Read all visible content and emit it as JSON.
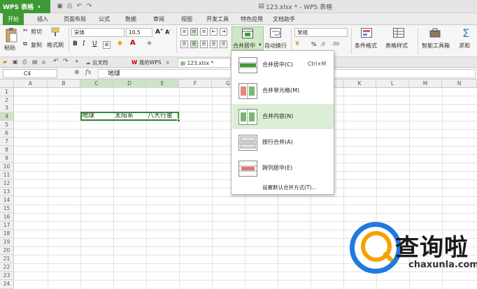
{
  "titlebar": {
    "app_name": "WPS 表格",
    "document_title": "123.xlsx * - WPS 表格"
  },
  "tabs": [
    "开始",
    "插入",
    "页面布局",
    "公式",
    "数据",
    "审阅",
    "视图",
    "开发工具",
    "特色应用",
    "文档助手"
  ],
  "ribbon": {
    "paste": "粘贴",
    "cut": "剪切",
    "copy": "复制",
    "format_painter": "格式刷",
    "font_name": "宋体",
    "font_size": "10.5",
    "bold": "B",
    "italic": "I",
    "underline": "U",
    "merge_center": "合并居中",
    "wrap_text": "自动换行",
    "number_format": "常规",
    "percent": "%",
    "conditional_format": "条件格式",
    "table_style": "表格样式",
    "smart_toolbox": "智能工具箱",
    "sum": "求和"
  },
  "doc_tabs": {
    "cloud_doc": "云文档",
    "my_wps": "我的WPS",
    "file": "123.xlsx *"
  },
  "formula_bar": {
    "cell_ref": "C4",
    "fx": "fx",
    "content": "地球"
  },
  "columns": [
    "A",
    "B",
    "C",
    "D",
    "E",
    "F",
    "G",
    "H",
    "I",
    "J",
    "K",
    "L",
    "M",
    "N"
  ],
  "rows": [
    "1",
    "2",
    "3",
    "4",
    "5",
    "6",
    "7",
    "8",
    "9",
    "10",
    "11",
    "12",
    "13",
    "14",
    "15",
    "16",
    "17",
    "18",
    "19",
    "20",
    "21",
    "22",
    "23",
    "24"
  ],
  "cells": {
    "C4": "地球",
    "D4": "太阳系",
    "E4": "八大行星"
  },
  "dropdown": {
    "items": [
      {
        "label": "合并居中(C)",
        "shortcut": "Ctrl+M"
      },
      {
        "label": "合并单元格(M)",
        "shortcut": ""
      },
      {
        "label": "合并内容(N)",
        "shortcut": ""
      },
      {
        "label": "按行合并(A)",
        "shortcut": ""
      },
      {
        "label": "跨列居中(E)",
        "shortcut": ""
      }
    ],
    "footer": "设置默认合并方式(T)..."
  },
  "watermark": {
    "text": "查询啦",
    "url": "chaxunla.com"
  },
  "colors": {
    "accent": "#3d9a34",
    "selection": "#2e8b2e",
    "menu_highlight": "#dcefd6"
  }
}
